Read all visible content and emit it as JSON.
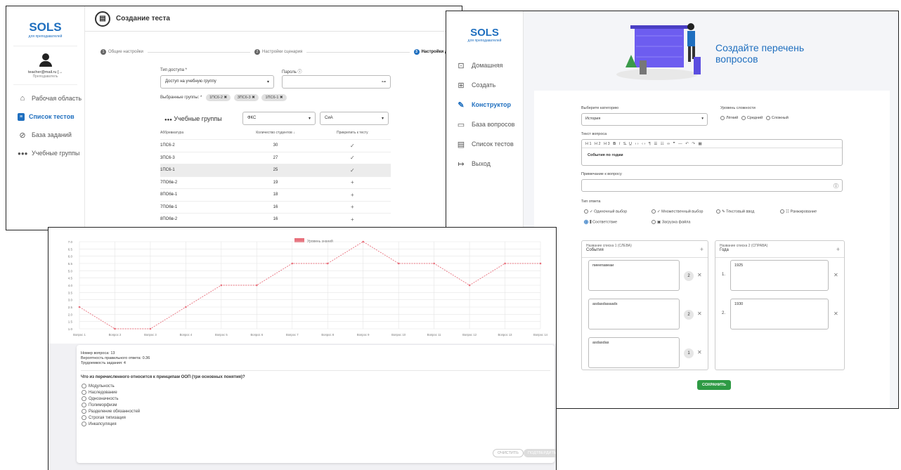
{
  "win1": {
    "logo": "SOLS",
    "logo_sub": "для преподавателей",
    "user_email": "teacher@mail.ru",
    "user_role": "Преподаватель",
    "nav": [
      {
        "label": "Рабочая область",
        "icon": "home-icon"
      },
      {
        "label": "Список тестов",
        "icon": "list-icon",
        "active": true
      },
      {
        "label": "База заданий",
        "icon": "check-circle-icon"
      },
      {
        "label": "Учебные группы",
        "icon": "groups-icon"
      }
    ],
    "page_title": "Создание теста",
    "steps": [
      {
        "num": "1",
        "label": "Общие настройки"
      },
      {
        "num": "2",
        "label": "Настройки сценария"
      },
      {
        "num": "3",
        "label": "Настройки доступа"
      }
    ],
    "access_type_label": "Тип доступа *",
    "access_type_value": "Доступ на учебную группу",
    "password_label": "Пароль",
    "selected_groups_label": "Выбранные группы: *",
    "chips": [
      "1ПС6-2",
      "3ПС6-3",
      "1ПС6-1"
    ],
    "groups_title": "Учебные группы",
    "filter1": "ФКС",
    "filter2": "СиА",
    "table_headers": [
      "Аббревиатура",
      "Количество студентов",
      "Прикрепить к тесту"
    ],
    "table_rows": [
      {
        "abbr": "1ПС6-2",
        "count": "30",
        "mark": "✓"
      },
      {
        "abbr": "3ПС6-3",
        "count": "27",
        "mark": "✓"
      },
      {
        "abbr": "1ПС6-1",
        "count": "25",
        "mark": "✓"
      },
      {
        "abbr": "7ПО6в-2",
        "count": "19",
        "mark": "+"
      },
      {
        "abbr": "8ПО6в-1",
        "count": "18",
        "mark": "+"
      },
      {
        "abbr": "7ПО6в-1",
        "count": "16",
        "mark": "+"
      },
      {
        "abbr": "8ПО6в-2",
        "count": "16",
        "mark": "+"
      },
      {
        "abbr": "9ПО63в-1",
        "count": "15",
        "mark": "+"
      }
    ]
  },
  "win2": {
    "logo": "SOLS",
    "logo_sub": "для преподавателей",
    "nav": [
      {
        "label": "Домашняя",
        "icon": "home-box-icon"
      },
      {
        "label": "Создать",
        "icon": "create-icon"
      },
      {
        "label": "Конструктор",
        "icon": "pencil-icon",
        "active": true
      },
      {
        "label": "База вопросов",
        "icon": "folder-icon"
      },
      {
        "label": "Список тестов",
        "icon": "document-icon"
      },
      {
        "label": "Выход",
        "icon": "logout-icon"
      }
    ],
    "hero_line1": "Создайте перечень",
    "hero_line2": "вопросов",
    "category_label": "Выберите категорию",
    "category_value": "История",
    "difficulty_label": "Уровень сложности",
    "difficulty_options": [
      "Лёгкий",
      "Средний",
      "Сложный"
    ],
    "question_text_label": "Текст вопроса",
    "question_text": "События по годам",
    "note_label": "Примечание к вопросу",
    "answer_type_label": "Тип ответа",
    "answer_types": [
      "Одиночный выбор",
      "Множественный выбор",
      "Текстовый ввод",
      "Ранжирование",
      "Соответствие",
      "Загрузка файла"
    ],
    "list1_caption": "Название списка 1 (СЛЕВА)",
    "list1_title": "События",
    "list2_caption": "Название списка 2 (СПРАВА)",
    "list2_title": "Года",
    "left_items": [
      {
        "text": "пиеепавеаи",
        "num": "2"
      },
      {
        "text": "asdasdasaads",
        "num": "2"
      },
      {
        "text": "asdasdas",
        "num": "1"
      }
    ],
    "right_items": [
      {
        "idx": "1.",
        "text": "1925"
      },
      {
        "idx": "2.",
        "text": "1930"
      }
    ],
    "save_label": "СОХРАНИТЬ"
  },
  "win3": {
    "legend": "Уровень знаний",
    "question_number": "Номер вопроса: 13",
    "probability": "Вероятность правильного ответа: 0.36",
    "difficulty": "Трудоемкость задания: 4",
    "question": "Что из перечисленного относится к принципам ООП (три основных понятия)?",
    "options": [
      "Модульность",
      "Наследование",
      "Однозначность",
      "Полиморфизм",
      "Разделение обязанностей",
      "Строгая типизация",
      "Инкапсуляция"
    ],
    "clear_label": "ОЧИСТИТЬ",
    "confirm_label": "ПОДТВЕРДИТЬ"
  },
  "chart_data": {
    "type": "line",
    "legend": "Уровень знаний",
    "x": [
      "Вопрос 1",
      "Вопрос 2",
      "Вопрос 3",
      "Вопрос 4",
      "Вопрос 5",
      "Вопрос 6",
      "Вопрос 7",
      "Вопрос 8",
      "Вопрос 9",
      "Вопрос 10",
      "Вопрос 11",
      "Вопрос 12",
      "Вопрос 13",
      "Вопрос 14"
    ],
    "values": [
      2.0,
      1.0,
      1.0,
      2.0,
      3.0,
      3.0,
      4.0,
      4.0,
      5.0,
      4.0,
      4.0,
      3.0,
      4.0,
      4.0
    ],
    "y_ticks": [
      "7.0",
      "6.5",
      "6.0",
      "5.5",
      "5.0",
      "4.5",
      "4.0",
      "3.5",
      "3.0",
      "2.5",
      "2.0",
      "1.5",
      "1.0"
    ],
    "ylim": [
      1,
      5
    ],
    "color": "#e8707c"
  }
}
